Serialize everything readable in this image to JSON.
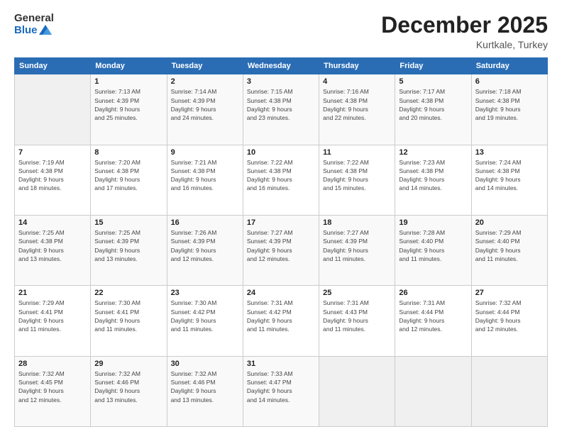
{
  "header": {
    "logo_general": "General",
    "logo_blue": "Blue",
    "main_title": "December 2025",
    "subtitle": "Kurtkale, Turkey"
  },
  "calendar": {
    "days_of_week": [
      "Sunday",
      "Monday",
      "Tuesday",
      "Wednesday",
      "Thursday",
      "Friday",
      "Saturday"
    ],
    "weeks": [
      [
        {
          "day": "",
          "info": ""
        },
        {
          "day": "1",
          "info": "Sunrise: 7:13 AM\nSunset: 4:39 PM\nDaylight: 9 hours\nand 25 minutes."
        },
        {
          "day": "2",
          "info": "Sunrise: 7:14 AM\nSunset: 4:39 PM\nDaylight: 9 hours\nand 24 minutes."
        },
        {
          "day": "3",
          "info": "Sunrise: 7:15 AM\nSunset: 4:38 PM\nDaylight: 9 hours\nand 23 minutes."
        },
        {
          "day": "4",
          "info": "Sunrise: 7:16 AM\nSunset: 4:38 PM\nDaylight: 9 hours\nand 22 minutes."
        },
        {
          "day": "5",
          "info": "Sunrise: 7:17 AM\nSunset: 4:38 PM\nDaylight: 9 hours\nand 20 minutes."
        },
        {
          "day": "6",
          "info": "Sunrise: 7:18 AM\nSunset: 4:38 PM\nDaylight: 9 hours\nand 19 minutes."
        }
      ],
      [
        {
          "day": "7",
          "info": "Sunrise: 7:19 AM\nSunset: 4:38 PM\nDaylight: 9 hours\nand 18 minutes."
        },
        {
          "day": "8",
          "info": "Sunrise: 7:20 AM\nSunset: 4:38 PM\nDaylight: 9 hours\nand 17 minutes."
        },
        {
          "day": "9",
          "info": "Sunrise: 7:21 AM\nSunset: 4:38 PM\nDaylight: 9 hours\nand 16 minutes."
        },
        {
          "day": "10",
          "info": "Sunrise: 7:22 AM\nSunset: 4:38 PM\nDaylight: 9 hours\nand 16 minutes."
        },
        {
          "day": "11",
          "info": "Sunrise: 7:22 AM\nSunset: 4:38 PM\nDaylight: 9 hours\nand 15 minutes."
        },
        {
          "day": "12",
          "info": "Sunrise: 7:23 AM\nSunset: 4:38 PM\nDaylight: 9 hours\nand 14 minutes."
        },
        {
          "day": "13",
          "info": "Sunrise: 7:24 AM\nSunset: 4:38 PM\nDaylight: 9 hours\nand 14 minutes."
        }
      ],
      [
        {
          "day": "14",
          "info": "Sunrise: 7:25 AM\nSunset: 4:38 PM\nDaylight: 9 hours\nand 13 minutes."
        },
        {
          "day": "15",
          "info": "Sunrise: 7:25 AM\nSunset: 4:39 PM\nDaylight: 9 hours\nand 13 minutes."
        },
        {
          "day": "16",
          "info": "Sunrise: 7:26 AM\nSunset: 4:39 PM\nDaylight: 9 hours\nand 12 minutes."
        },
        {
          "day": "17",
          "info": "Sunrise: 7:27 AM\nSunset: 4:39 PM\nDaylight: 9 hours\nand 12 minutes."
        },
        {
          "day": "18",
          "info": "Sunrise: 7:27 AM\nSunset: 4:39 PM\nDaylight: 9 hours\nand 11 minutes."
        },
        {
          "day": "19",
          "info": "Sunrise: 7:28 AM\nSunset: 4:40 PM\nDaylight: 9 hours\nand 11 minutes."
        },
        {
          "day": "20",
          "info": "Sunrise: 7:29 AM\nSunset: 4:40 PM\nDaylight: 9 hours\nand 11 minutes."
        }
      ],
      [
        {
          "day": "21",
          "info": "Sunrise: 7:29 AM\nSunset: 4:41 PM\nDaylight: 9 hours\nand 11 minutes."
        },
        {
          "day": "22",
          "info": "Sunrise: 7:30 AM\nSunset: 4:41 PM\nDaylight: 9 hours\nand 11 minutes."
        },
        {
          "day": "23",
          "info": "Sunrise: 7:30 AM\nSunset: 4:42 PM\nDaylight: 9 hours\nand 11 minutes."
        },
        {
          "day": "24",
          "info": "Sunrise: 7:31 AM\nSunset: 4:42 PM\nDaylight: 9 hours\nand 11 minutes."
        },
        {
          "day": "25",
          "info": "Sunrise: 7:31 AM\nSunset: 4:43 PM\nDaylight: 9 hours\nand 11 minutes."
        },
        {
          "day": "26",
          "info": "Sunrise: 7:31 AM\nSunset: 4:44 PM\nDaylight: 9 hours\nand 12 minutes."
        },
        {
          "day": "27",
          "info": "Sunrise: 7:32 AM\nSunset: 4:44 PM\nDaylight: 9 hours\nand 12 minutes."
        }
      ],
      [
        {
          "day": "28",
          "info": "Sunrise: 7:32 AM\nSunset: 4:45 PM\nDaylight: 9 hours\nand 12 minutes."
        },
        {
          "day": "29",
          "info": "Sunrise: 7:32 AM\nSunset: 4:46 PM\nDaylight: 9 hours\nand 13 minutes."
        },
        {
          "day": "30",
          "info": "Sunrise: 7:32 AM\nSunset: 4:46 PM\nDaylight: 9 hours\nand 13 minutes."
        },
        {
          "day": "31",
          "info": "Sunrise: 7:33 AM\nSunset: 4:47 PM\nDaylight: 9 hours\nand 14 minutes."
        },
        {
          "day": "",
          "info": ""
        },
        {
          "day": "",
          "info": ""
        },
        {
          "day": "",
          "info": ""
        }
      ]
    ]
  }
}
